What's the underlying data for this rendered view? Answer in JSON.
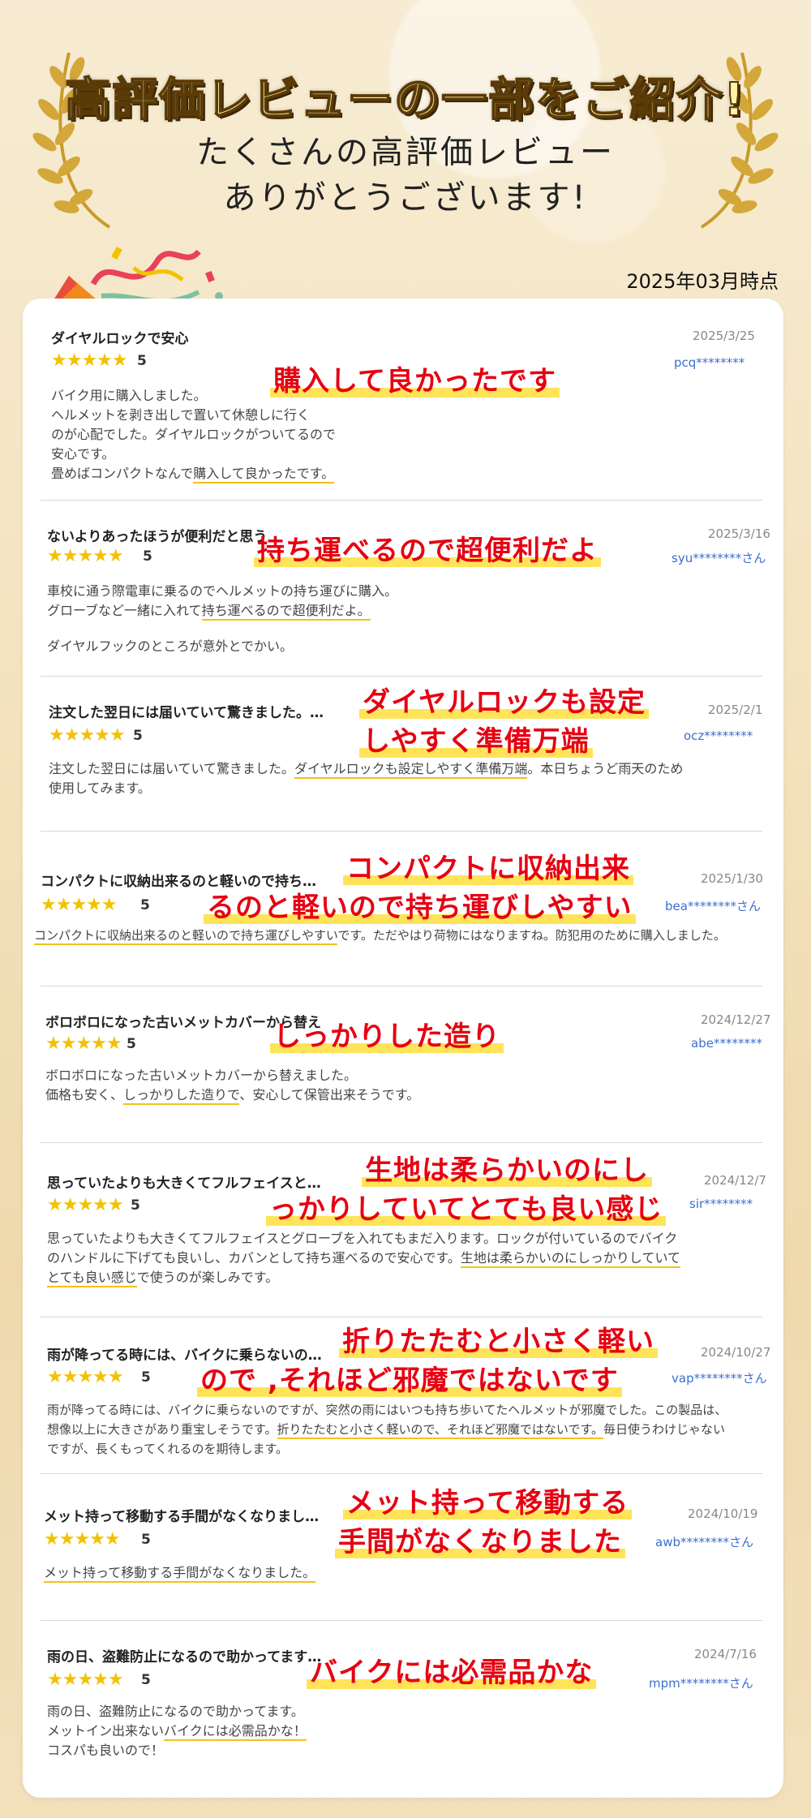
{
  "header": {
    "main_title": "高評価レビューの一部をご紹介!",
    "sub_line1": "たくさんの高評価レビュー",
    "sub_line2": "ありがとうございます!",
    "as_of": "2025年03月時点"
  },
  "colors": {
    "star": "#f2c200",
    "callout": "#e60012",
    "highlight": "#ffe45a",
    "user": "#3a6fd0",
    "laurel": "#c99a2a"
  },
  "icons": [
    "laurel-left-icon",
    "laurel-right-icon",
    "party-popper-icon",
    "star-icon"
  ],
  "reviews": [
    {
      "title": "ダイヤルロックで安心",
      "date": "2025/3/25",
      "user": "pcq********",
      "stars": "★★★★★",
      "score": "5",
      "callout1": "購入して良かったです",
      "callout2": "",
      "body": {
        "l1": "バイク用に購入しました。",
        "l2": "ヘルメットを剥き出しで置いて休憩しに行く",
        "l3": "のが心配でした。ダイヤルロックがついてるので",
        "l4": "安心です。",
        "l5a": "畳めばコンパクトなんで",
        "l5u": "購入して良かったです。"
      }
    },
    {
      "title": "ないよりあったほうが便利だと思う",
      "date": "2025/3/16",
      "user": "syu********さん",
      "stars": "★★★★★",
      "score": "5",
      "callout1": "持ち運べるので超便利だよ",
      "callout2": "",
      "body": {
        "l1": "車校に通う際電車に乗るのでヘルメットの持ち運びに購入。",
        "l2a": "グローブなど一緒に入れて",
        "l2u": "持ち運べるので超便利だよ。",
        "l3": "ダイヤルフックのところが意外とでかい。"
      }
    },
    {
      "title": "注文した翌日には届いていて驚きました。…",
      "date": "2025/2/1",
      "user": "ocz********",
      "stars": "★★★★★",
      "score": "5",
      "callout1": "ダイヤルロックも設定",
      "callout2": "しやすく準備万端",
      "body": {
        "l1a": "注文した翌日には届いていて驚きました。",
        "l1u": "ダイヤルロックも設定しやすく準備万端",
        "l1b": "。本日ちょうど雨天のため",
        "l2": "使用してみます。"
      }
    },
    {
      "title": "コンパクトに収納出来るのと軽いので持ち…",
      "date": "2025/1/30",
      "user": "bea********さん",
      "stars": "★★★★★",
      "score": "5",
      "callout1": "コンパクトに収納出来",
      "callout2": "るのと軽いので持ち運びしやすい",
      "body": {
        "l1u": "コンパクトに収納出来るのと軽いので持ち運びしやすい",
        "l1b": "です。ただやはり荷物にはなりますね。防犯用のために購入しました。"
      }
    },
    {
      "title": "ボロボロになった古いメットカバーから替え",
      "date": "2024/12/27",
      "user": "abe********",
      "stars": "★★★★★",
      "score": "5",
      "callout1": "しっかりした造り",
      "callout2": "",
      "body": {
        "l1": "ボロボロになった古いメットカバーから替えました。",
        "l2a": "価格も安く、",
        "l2u": "しっかりした造りで",
        "l2b": "、安心して保管出来そうです。"
      }
    },
    {
      "title": "思っていたよりも大きくてフルフェイスと…",
      "date": "2024/12/7",
      "user": "sir********",
      "stars": "★★★★★",
      "score": "5",
      "callout1": "生地は柔らかいのにし",
      "callout2": "っかりしていてとても良い感じ",
      "body": {
        "l1": "思っていたよりも大きくてフルフェイスとグローブを入れてもまだ入ります。ロックが付いているのでバイク",
        "l2a": "のハンドルに下げても良いし、カバンとして持ち運べるので安心です。",
        "l2u": "生地は柔らかいのにしっかりしていて",
        "l3u": "とても良い感じ",
        "l3b": "で使うのが楽しみです。"
      }
    },
    {
      "title": "雨が降ってる時には、バイクに乗らないの…",
      "date": "2024/10/27",
      "user": "vap********さん",
      "stars": "★★★★★",
      "score": "5",
      "callout1": "折りたたむと小さく軽い",
      "callout2": "ので ,それほど邪魔ではないです",
      "body": {
        "l1": "雨が降ってる時には、バイクに乗らないのですが、突然の雨にはいつも持ち歩いてたヘルメットが邪魔でした。この製品は、",
        "l2a": "想像以上に大きさがあり重宝しそうです。",
        "l2u": "折りたたむと小さく軽いので、それほど邪魔ではないです。",
        "l2b": "毎日使うわけじゃない",
        "l3": "ですが、長くもってくれるのを期待します。"
      }
    },
    {
      "title": "メット持って移動する手間がなくなりまし…",
      "date": "2024/10/19",
      "user": "awb********さん",
      "stars": "★★★★★",
      "score": "5",
      "callout1": "メット持って移動する",
      "callout2": "手間がなくなりました",
      "body": {
        "l1u": "メット持って移動する手間がなくなりました。"
      }
    },
    {
      "title": "雨の日、盗難防止になるので助かってます…",
      "date": "2024/7/16",
      "user": "mpm********さん",
      "stars": "★★★★★",
      "score": "5",
      "callout1": "バイクには必需品かな",
      "callout2": "",
      "body": {
        "l1": "雨の日、盗難防止になるので助かってます。",
        "l2a": "メットイン出来ない",
        "l2u": "バイクには必需品かな！",
        "l3": "コスパも良いので！"
      }
    }
  ]
}
